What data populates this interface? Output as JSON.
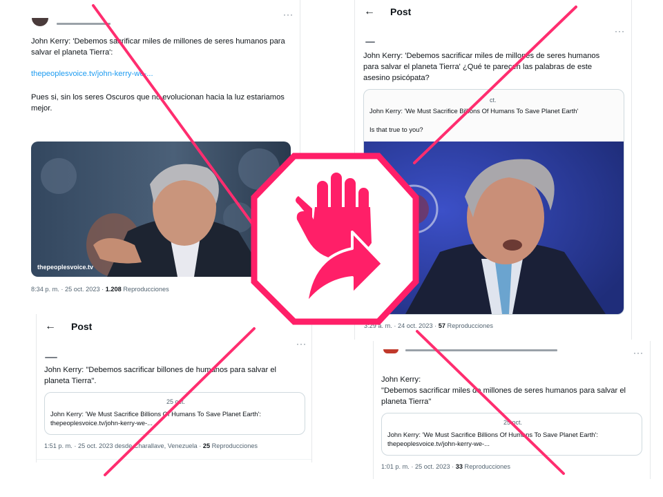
{
  "card1": {
    "text1": "John Kerry: 'Debemos sacrificar miles de millones de seres humanos para salvar el planeta Tierra':",
    "link": "thepeoplesvoice.tv/john-kerry-we-...",
    "text2": "Pues si, sin los seres Oscuros que no evolucionan hacia la luz estariamos mejor.",
    "image_watermark": "thepeoplesvoice.tv",
    "time": "8:34 p. m. · 25 oct. 2023 · ",
    "views_count": "1.208",
    "views_label": " Reproducciones"
  },
  "card2": {
    "header_title": "Post",
    "text": "John Kerry: 'Debemos sacrificar miles de millones de seres humanos para salvar el planeta Tierra'  ¿Qué te parecen las palabras de este asesino psicópata?",
    "quote_date": "ct.",
    "quote_text": "John Kerry: 'We Must Sacrifice Billions Of Humans To Save Planet Earth'",
    "quote_question": "Is that true to you?",
    "time": "3:29 a. m. · 24 oct. 2023 · ",
    "views_count": "57",
    "views_label": " Reproducciones"
  },
  "card3": {
    "header_title": "Post",
    "text": "John Kerry: \"Debemos sacrificar billones de humanos para salvar el planeta Tierra\".",
    "quote_date": "25 oct.",
    "quote_text": "John Kerry: 'We Must Sacrifice Billions Of Humans To Save Planet Earth': thepeoplesvoice.tv/john-kerry-we-...",
    "time": "1:51 p. m. · 25 oct. 2023 desde Charallave, Venezuela · ",
    "views_count": "25",
    "views_label": " Reproducciones"
  },
  "card4": {
    "text": "John Kerry:\n\"Debemos sacrificar miles de millones de seres humanos para salvar el planeta Tierra\"",
    "quote_date": "25 oct.",
    "quote_text": "John Kerry: 'We Must Sacrifice Billions Of Humans To Save Planet Earth': thepeoplesvoice.tv/john-kerry-we-...",
    "time": "1:01 p. m. · 25 oct. 2023 · ",
    "views_count": "33",
    "views_label": " Reproducciones"
  },
  "menu_glyph": "···",
  "back_glyph": "←",
  "icons": {
    "stop": "stop-hand-share-arrow-icon",
    "back": "back-arrow-icon",
    "more": "more-options-icon"
  },
  "colors": {
    "cross": "#ff2d6f",
    "stop_badge": "#ff1f68",
    "link": "#1d9bf0",
    "muted": "#536471"
  }
}
